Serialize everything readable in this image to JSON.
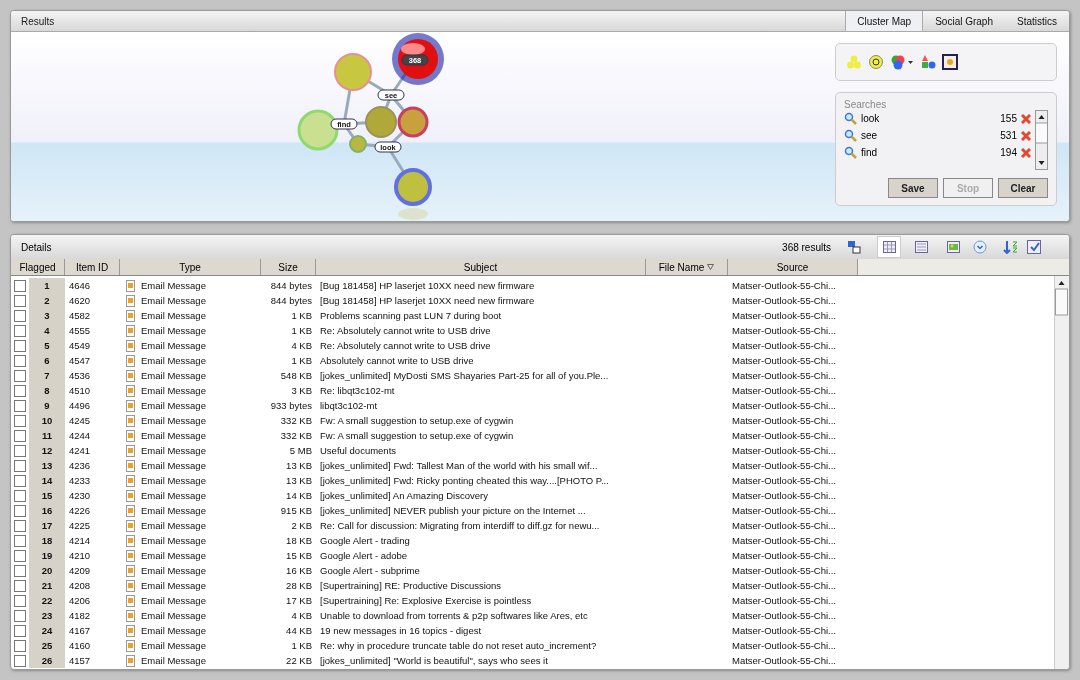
{
  "results": {
    "title": "Results",
    "tabs": [
      {
        "label": "Cluster Map",
        "selected": true
      },
      {
        "label": "Social Graph",
        "selected": false
      },
      {
        "label": "Statistics",
        "selected": false
      }
    ],
    "cluster_labels": [
      {
        "kind": "count",
        "text": "368"
      },
      {
        "kind": "term",
        "text": "see"
      },
      {
        "kind": "term",
        "text": "find"
      },
      {
        "kind": "term",
        "text": "look"
      }
    ],
    "searches": {
      "title": "Searches",
      "items": [
        {
          "term": "look",
          "count": "155"
        },
        {
          "term": "see",
          "count": "531"
        },
        {
          "term": "find",
          "count": "194"
        }
      ]
    },
    "buttons": [
      {
        "label": "Save",
        "disabled": false
      },
      {
        "label": "Stop",
        "disabled": true
      },
      {
        "label": "Clear",
        "disabled": false
      }
    ]
  },
  "details": {
    "title": "Details",
    "count": "368 results",
    "view_buttons": [
      {
        "selected": true
      },
      {
        "selected": false
      },
      {
        "selected": false
      }
    ],
    "columns": [
      {
        "label": "Flagged",
        "sorted": false
      },
      {
        "label": "Item ID",
        "sorted": false
      },
      {
        "label": "Type",
        "sorted": false
      },
      {
        "label": "Size",
        "sorted": false
      },
      {
        "label": "Subject",
        "sorted": false
      },
      {
        "label": "File Name",
        "sorted": true
      },
      {
        "label": "Source",
        "sorted": false
      }
    ],
    "rows": [
      {
        "flagged": false,
        "num": "1",
        "id": "4646",
        "type": "Email Message",
        "size": "844 bytes",
        "subject": "[Bug 181458] HP laserjet 10XX need new firmware",
        "source": "Matser-Outlook-55-Chi..."
      },
      {
        "flagged": false,
        "num": "2",
        "id": "4620",
        "type": "Email Message",
        "size": "844 bytes",
        "subject": "[Bug 181458] HP laserjet 10XX need new firmware",
        "source": "Matser-Outlook-55-Chi..."
      },
      {
        "flagged": false,
        "num": "3",
        "id": "4582",
        "type": "Email Message",
        "size": "1 KB",
        "subject": "Problems scanning past LUN 7 during boot",
        "source": "Matser-Outlook-55-Chi..."
      },
      {
        "flagged": false,
        "num": "4",
        "id": "4555",
        "type": "Email Message",
        "size": "1 KB",
        "subject": "Re: Absolutely cannot write to USB drive",
        "source": "Matser-Outlook-55-Chi..."
      },
      {
        "flagged": false,
        "num": "5",
        "id": "4549",
        "type": "Email Message",
        "size": "4 KB",
        "subject": "Re: Absolutely cannot write to USB drive",
        "source": "Matser-Outlook-55-Chi..."
      },
      {
        "flagged": false,
        "num": "6",
        "id": "4547",
        "type": "Email Message",
        "size": "1 KB",
        "subject": "Absolutely cannot write to USB drive",
        "source": "Matser-Outlook-55-Chi..."
      },
      {
        "flagged": false,
        "num": "7",
        "id": "4536",
        "type": "Email Message",
        "size": "548 KB",
        "subject": "[jokes_unlimited] MyDosti SMS Shayaries Part-25 for all of you.Ple...",
        "source": "Matser-Outlook-55-Chi..."
      },
      {
        "flagged": false,
        "num": "8",
        "id": "4510",
        "type": "Email Message",
        "size": "3 KB",
        "subject": "Re: libqt3c102-mt",
        "source": "Matser-Outlook-55-Chi..."
      },
      {
        "flagged": false,
        "num": "9",
        "id": "4496",
        "type": "Email Message",
        "size": "933 bytes",
        "subject": "libqt3c102-mt",
        "source": "Matser-Outlook-55-Chi..."
      },
      {
        "flagged": false,
        "num": "10",
        "id": "4245",
        "type": "Email Message",
        "size": "332 KB",
        "subject": "Fw: A small suggestion to setup.exe of cygwin",
        "source": "Matser-Outlook-55-Chi..."
      },
      {
        "flagged": false,
        "num": "11",
        "id": "4244",
        "type": "Email Message",
        "size": "332 KB",
        "subject": "Fw: A small suggestion to setup.exe of cygwin",
        "source": "Matser-Outlook-55-Chi..."
      },
      {
        "flagged": false,
        "num": "12",
        "id": "4241",
        "type": "Email Message",
        "size": "5 MB",
        "subject": "Useful documents",
        "source": "Matser-Outlook-55-Chi..."
      },
      {
        "flagged": false,
        "num": "13",
        "id": "4236",
        "type": "Email Message",
        "size": "13 KB",
        "subject": "[jokes_unlimited] Fwd: Tallest Man of the world with his small wif...",
        "source": "Matser-Outlook-55-Chi..."
      },
      {
        "flagged": false,
        "num": "14",
        "id": "4233",
        "type": "Email Message",
        "size": "13 KB",
        "subject": "[jokes_unlimited] Fwd: Ricky ponting cheated this way....[PHOTO P...",
        "source": "Matser-Outlook-55-Chi..."
      },
      {
        "flagged": false,
        "num": "15",
        "id": "4230",
        "type": "Email Message",
        "size": "14 KB",
        "subject": "[jokes_unlimited] An Amazing Discovery",
        "source": "Matser-Outlook-55-Chi..."
      },
      {
        "flagged": false,
        "num": "16",
        "id": "4226",
        "type": "Email Message",
        "size": "915 KB",
        "subject": "[jokes_unlimited] NEVER publish your picture on the Internet ...",
        "source": "Matser-Outlook-55-Chi..."
      },
      {
        "flagged": false,
        "num": "17",
        "id": "4225",
        "type": "Email Message",
        "size": "2 KB",
        "subject": "Re: Call for discussion: Migrating from interdiff to diff.gz for newu...",
        "source": "Matser-Outlook-55-Chi..."
      },
      {
        "flagged": false,
        "num": "18",
        "id": "4214",
        "type": "Email Message",
        "size": "18 KB",
        "subject": "Google Alert - trading",
        "source": "Matser-Outlook-55-Chi..."
      },
      {
        "flagged": false,
        "num": "19",
        "id": "4210",
        "type": "Email Message",
        "size": "15 KB",
        "subject": "Google Alert - adobe",
        "source": "Matser-Outlook-55-Chi..."
      },
      {
        "flagged": false,
        "num": "20",
        "id": "4209",
        "type": "Email Message",
        "size": "16 KB",
        "subject": "Google Alert - subprime",
        "source": "Matser-Outlook-55-Chi..."
      },
      {
        "flagged": false,
        "num": "21",
        "id": "4208",
        "type": "Email Message",
        "size": "28 KB",
        "subject": "[Supertraining] RE: Productive Discussions",
        "source": "Matser-Outlook-55-Chi..."
      },
      {
        "flagged": false,
        "num": "22",
        "id": "4206",
        "type": "Email Message",
        "size": "17 KB",
        "subject": "[Supertraining] Re: Explosive Exercise is pointless",
        "source": "Matser-Outlook-55-Chi..."
      },
      {
        "flagged": false,
        "num": "23",
        "id": "4182",
        "type": "Email Message",
        "size": "4 KB",
        "subject": "Unable to download from torrents & p2p softwares like Ares, etc",
        "source": "Matser-Outlook-55-Chi..."
      },
      {
        "flagged": false,
        "num": "24",
        "id": "4167",
        "type": "Email Message",
        "size": "44 KB",
        "subject": "19 new messages in 16 topics - digest",
        "source": "Matser-Outlook-55-Chi..."
      },
      {
        "flagged": false,
        "num": "25",
        "id": "4160",
        "type": "Email Message",
        "size": "1 KB",
        "subject": "Re: why in procedure truncate table do not reset auto_increment?",
        "source": "Matser-Outlook-55-Chi..."
      },
      {
        "flagged": false,
        "num": "26",
        "id": "4157",
        "type": "Email Message",
        "size": "22 KB",
        "subject": "[jokes_unlimited] \"World is beautiful\", says who sees it",
        "source": "Matser-Outlook-55-Chi..."
      }
    ]
  }
}
